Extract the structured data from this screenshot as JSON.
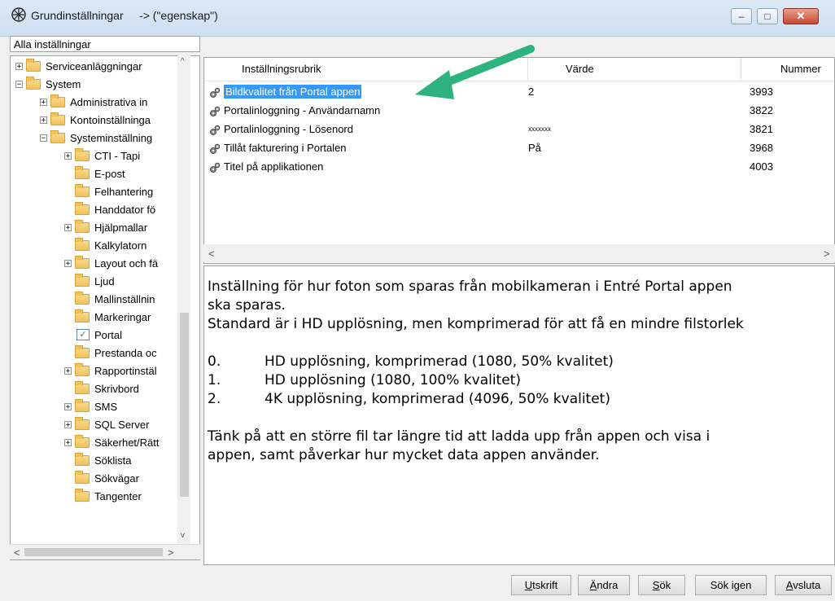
{
  "window": {
    "title": "Grundinställningar     -> (\"egenskap\")",
    "minimize_glyph": "–",
    "maximize_glyph": "□",
    "close_glyph": "✕"
  },
  "left_panel": {
    "header": "Alla inställningar",
    "tree": [
      {
        "label": "Serviceanläggningar",
        "level": 0,
        "expander": "+"
      },
      {
        "label": "System",
        "level": 0,
        "expander": "−"
      },
      {
        "label": "Administrativa in",
        "level": 1,
        "expander": "+"
      },
      {
        "label": "Kontoinställninga",
        "level": 1,
        "expander": "+"
      },
      {
        "label": "Systeminställning",
        "level": 1,
        "expander": "−"
      },
      {
        "label": "CTI - Tapi",
        "level": 2,
        "expander": "+"
      },
      {
        "label": "E-post",
        "level": 2,
        "expander": ""
      },
      {
        "label": "Felhantering",
        "level": 2,
        "expander": ""
      },
      {
        "label": "Handdator fö",
        "level": 2,
        "expander": ""
      },
      {
        "label": "Hjälpmallar",
        "level": 2,
        "expander": "+"
      },
      {
        "label": "Kalkylatorn",
        "level": 2,
        "expander": ""
      },
      {
        "label": "Layout och fä",
        "level": 2,
        "expander": "+"
      },
      {
        "label": "Ljud",
        "level": 2,
        "expander": ""
      },
      {
        "label": "Mallinställnin",
        "level": 2,
        "expander": ""
      },
      {
        "label": "Markeringar",
        "level": 2,
        "expander": ""
      },
      {
        "label": "Portal",
        "level": 2,
        "expander": "",
        "icon": "portal"
      },
      {
        "label": "Prestanda oc",
        "level": 2,
        "expander": ""
      },
      {
        "label": "Rapportinstäl",
        "level": 2,
        "expander": "+"
      },
      {
        "label": "Skrivbord",
        "level": 2,
        "expander": ""
      },
      {
        "label": "SMS",
        "level": 2,
        "expander": "+"
      },
      {
        "label": "SQL Server",
        "level": 2,
        "expander": "+"
      },
      {
        "label": "Säkerhet/Rätt",
        "level": 2,
        "expander": "+"
      },
      {
        "label": "Söklista",
        "level": 2,
        "expander": ""
      },
      {
        "label": "Sökvägar",
        "level": 2,
        "expander": ""
      },
      {
        "label": "Tangenter",
        "level": 2,
        "expander": ""
      }
    ]
  },
  "grid": {
    "columns": [
      "Inställningsrubrik",
      "Värde",
      "Nummer"
    ],
    "rows": [
      {
        "name": "Bildkvalitet från Portal appen",
        "value": "2",
        "number": "3993",
        "selected": true
      },
      {
        "name": "Portalinloggning - Användarnamn",
        "value": "",
        "number": "3822"
      },
      {
        "name": "Portalinloggning - Lösenord",
        "value": "xxxxxxx",
        "number": "3821"
      },
      {
        "name": "Tillåt fakturering i Portalen",
        "value": "På",
        "number": "3968"
      },
      {
        "name": "Titel på applikationen",
        "value": "",
        "number": "4003"
      }
    ]
  },
  "description": {
    "line1": "Inställning för hur foton som sparas från mobilkameran i Entré Portal appen",
    "line2": "ska sparas.",
    "line3": "Standard är i HD upplösning, men komprimerad för att få en mindre filstorlek",
    "options": [
      {
        "num": "0.",
        "text": "HD upplösning, komprimerad  (1080,  50% kvalitet)"
      },
      {
        "num": "1.",
        "text": "HD upplösning (1080, 100% kvalitet)"
      },
      {
        "num": "2.",
        "text": "4K upplösning, komprimerad  (4096,  50% kvalitet)"
      }
    ],
    "line4": "Tänk på att en större fil tar längre tid att ladda upp från appen och visa i",
    "line5": "appen, samt påverkar hur mycket data appen använder."
  },
  "buttons": {
    "print": {
      "u": "U",
      "rest": "tskrift"
    },
    "edit": {
      "u": "Ä",
      "rest": "ndra"
    },
    "search": {
      "u": "S",
      "rest": "ök"
    },
    "search_again": "Sök igen",
    "quit": {
      "u": "A",
      "rest": "vsluta"
    }
  },
  "colors": {
    "selection": "#3399ff",
    "arrow": "#2fb37e"
  }
}
